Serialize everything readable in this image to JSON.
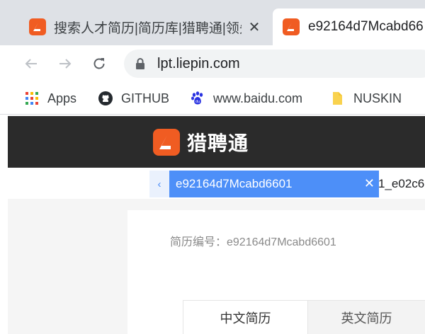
{
  "browser": {
    "tabs": [
      {
        "title": "搜索人才简历|简历库|猎聘通|领先",
        "active": false,
        "close": "✕"
      },
      {
        "title": "e92164d7Mcabd66",
        "active": true
      }
    ],
    "url": "lpt.liepin.com"
  },
  "bookmarks": [
    {
      "label": "Apps",
      "icon": "apps-grid-icon"
    },
    {
      "label": "GITHUB",
      "icon": "github-icon"
    },
    {
      "label": "www.baidu.com",
      "icon": "baidu-paw-icon"
    },
    {
      "label": "NUSKIN",
      "icon": "folder-icon"
    }
  ],
  "site": {
    "brand": "猎聘通",
    "brand_color": "#f05c22",
    "header_bg": "#2b2b2b"
  },
  "resume_tabs": {
    "prev": "‹",
    "active": "e92164d7Mcabd6601",
    "active_close": "✕",
    "next": "1_e02c6"
  },
  "resume": {
    "id_label": "简历编号：e92164d7Mcabd6601",
    "lang_tabs": [
      "中文简历",
      "英文简历"
    ]
  },
  "accent": "#4d8ff8"
}
